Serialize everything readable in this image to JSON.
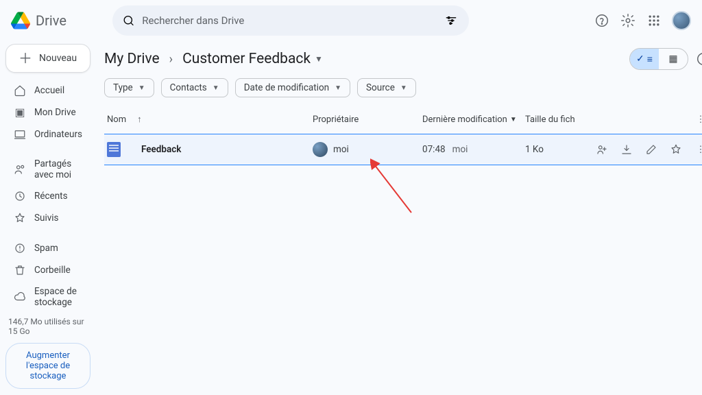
{
  "product": "Drive",
  "search": {
    "placeholder": "Rechercher dans Drive"
  },
  "new_btn": "Nouveau",
  "nav": {
    "home": "Accueil",
    "mydrive": "Mon Drive",
    "computers": "Ordinateurs",
    "shared": "Partagés avec moi",
    "recent": "Récents",
    "starred": "Suivis",
    "spam": "Spam",
    "trash": "Corbeille",
    "storage": "Espace de stockage"
  },
  "storage_line": "146,7 Mo utilisés sur 15 Go",
  "upgrade": "Augmenter l'espace de stockage",
  "breadcrumbs": {
    "a": "My Drive",
    "b": "Customer Feedback"
  },
  "chips": {
    "type": "Type",
    "contacts": "Contacts",
    "date": "Date de modification",
    "source": "Source"
  },
  "columns": {
    "name": "Nom",
    "owner": "Propriétaire",
    "modified": "Dernière modification",
    "size": "Taille du fich"
  },
  "row": {
    "name": "Feedback",
    "owner": "moi",
    "modified_time": "07:48",
    "modified_by": "moi",
    "size": "1 Ko"
  }
}
